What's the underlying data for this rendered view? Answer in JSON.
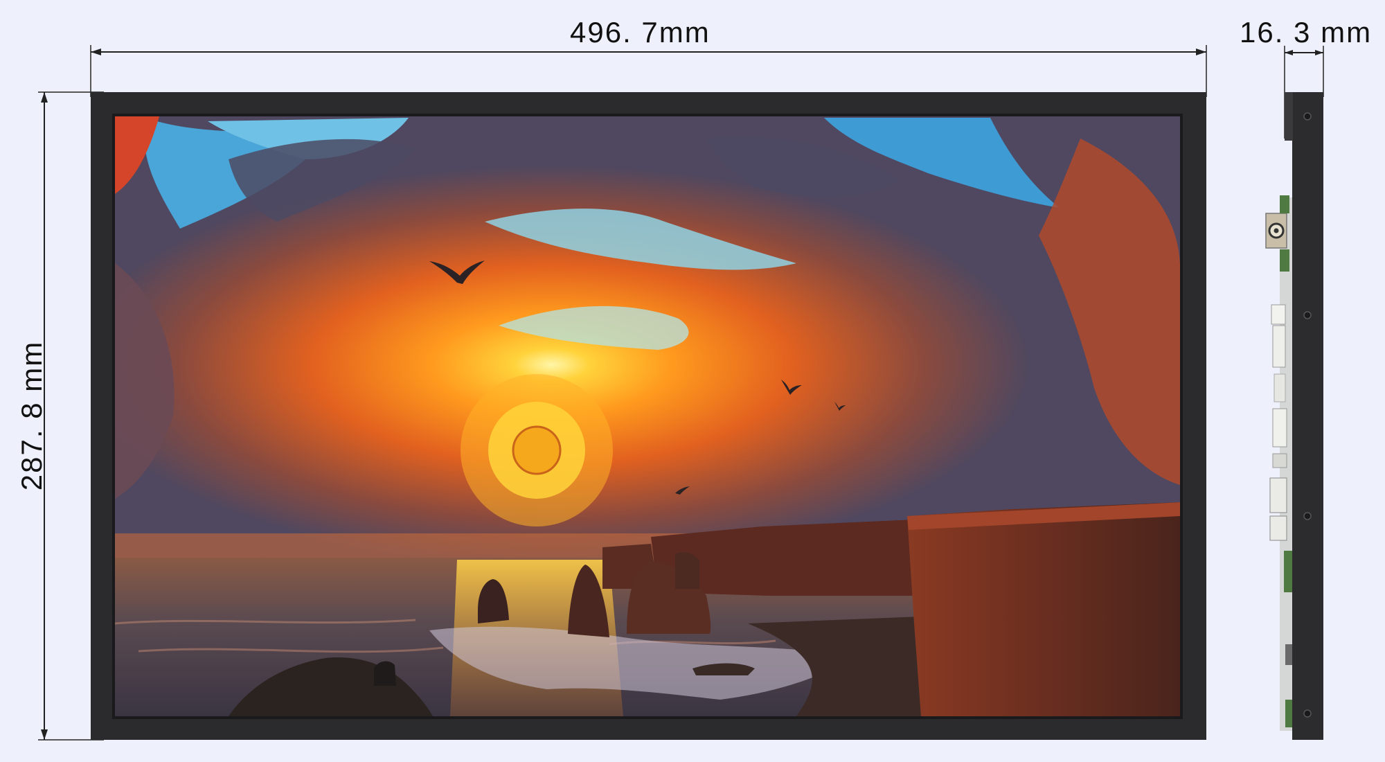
{
  "dimensions": {
    "width_label": "496. 7mm",
    "height_label": "287. 8 mm",
    "depth_label": "16. 3 mm"
  },
  "colors": {
    "background": "#eef1fb",
    "bezel": "#2b2b2e",
    "dimension_line": "#222222"
  },
  "screen_image": "sunset over sea cliffs with swirling clouds and birds",
  "side_view_parts": [
    "side-connector-port",
    "side-pcb-components",
    "mounting-screws"
  ]
}
